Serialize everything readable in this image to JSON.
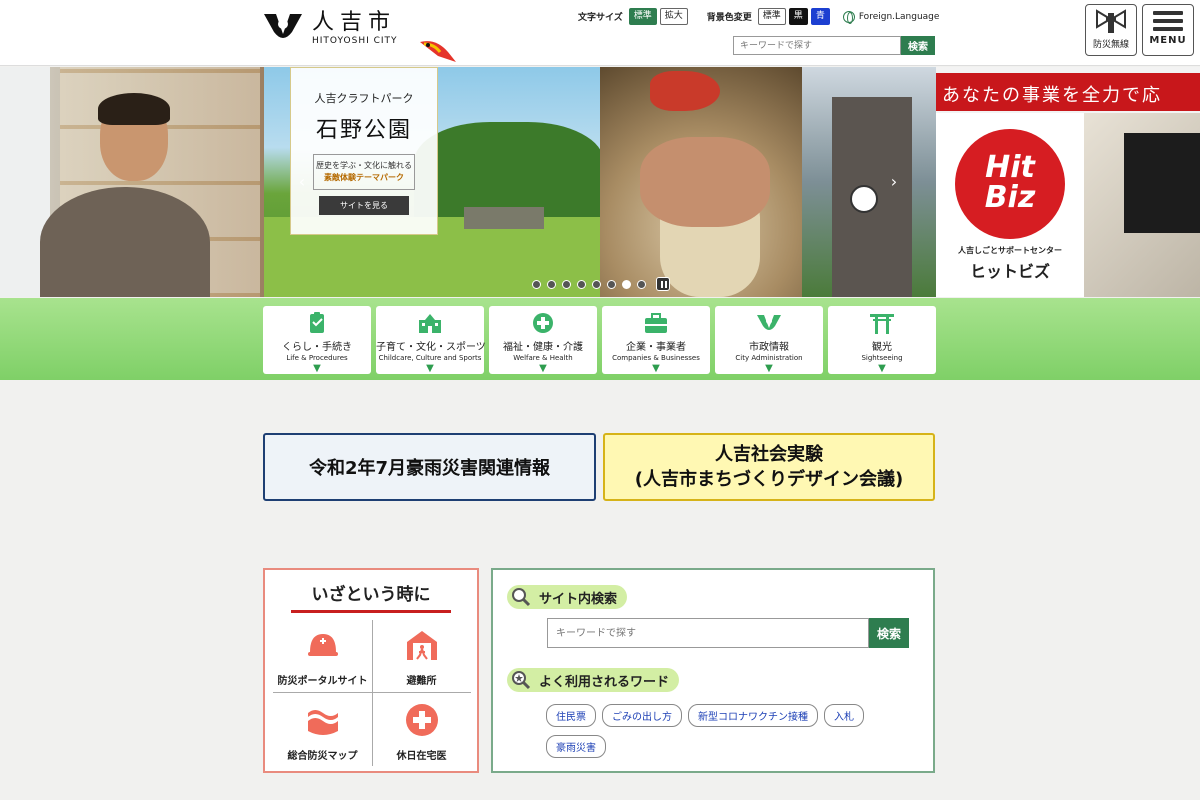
{
  "header": {
    "logo_jp": "人吉市",
    "logo_en": "HITOYOSHI CITY",
    "font_size_label": "文字サイズ",
    "font_standard": "標準",
    "font_large": "拡大",
    "bg_color_label": "背景色変更",
    "bg_standard": "標準",
    "bg_black": "黒",
    "bg_blue": "青",
    "foreign_language": "Foreign.Language",
    "search_placeholder": "キーワードで探す",
    "search_button": "検索",
    "bousai_label": "防災無線",
    "menu_label": "MENU"
  },
  "hero": {
    "card_sub": "人吉クラフトパーク",
    "card_title": "石野公園",
    "card_line1": "歴史を学ぶ・文化に触れる",
    "card_line2": "素敵体験テーマパーク",
    "card_button": "サイトを見る",
    "biz_band": "あなたの事業を全力で応",
    "biz_logo_line1": "Hit",
    "biz_logo_line2": "Biz",
    "biz_small": "人吉しごとサポートセンター",
    "biz_big": "ヒットビズ",
    "prev_arrow": "‹",
    "next_arrow": "›",
    "slide_count": 8,
    "active_slide": 6
  },
  "categories": [
    {
      "jp": "くらし・手続き",
      "en": "Life & Procedures",
      "icon": "clipboard-icon"
    },
    {
      "jp": "子育て・文化・スポーツ",
      "en": "Childcare, Culture and Sports",
      "icon": "school-icon"
    },
    {
      "jp": "福祉・健康・介護",
      "en": "Welfare & Health",
      "icon": "health-cross-icon"
    },
    {
      "jp": "企業・事業者",
      "en": "Companies & Businesses",
      "icon": "briefcase-icon"
    },
    {
      "jp": "市政情報",
      "en": "City Administration",
      "icon": "city-emblem-icon"
    },
    {
      "jp": "観光",
      "en": "Sightseeing",
      "icon": "torii-icon"
    }
  ],
  "banners": {
    "flood_info": "令和2年7月豪雨災害関連情報",
    "social_line1": "人吉社会実験",
    "social_line2": "(人吉市まちづくりデザイン会議)"
  },
  "emergency": {
    "title": "いざという時に",
    "items": [
      "防災ポータルサイト",
      "避難所",
      "総合防災マップ",
      "休日在宅医"
    ]
  },
  "site_search": {
    "heading": "サイト内検索",
    "placeholder": "キーワードで探す",
    "button": "検索",
    "popular_heading": "よく利用されるワード",
    "words": [
      "住民票",
      "ごみの出し方",
      "新型コロナワクチン接種",
      "入札",
      "豪雨災害"
    ]
  },
  "colors": {
    "brand_green": "#2e7d4f",
    "nav_green": "#8fd977",
    "alert_red": "#c81f1f",
    "link_blue": "#1c3fb5"
  }
}
